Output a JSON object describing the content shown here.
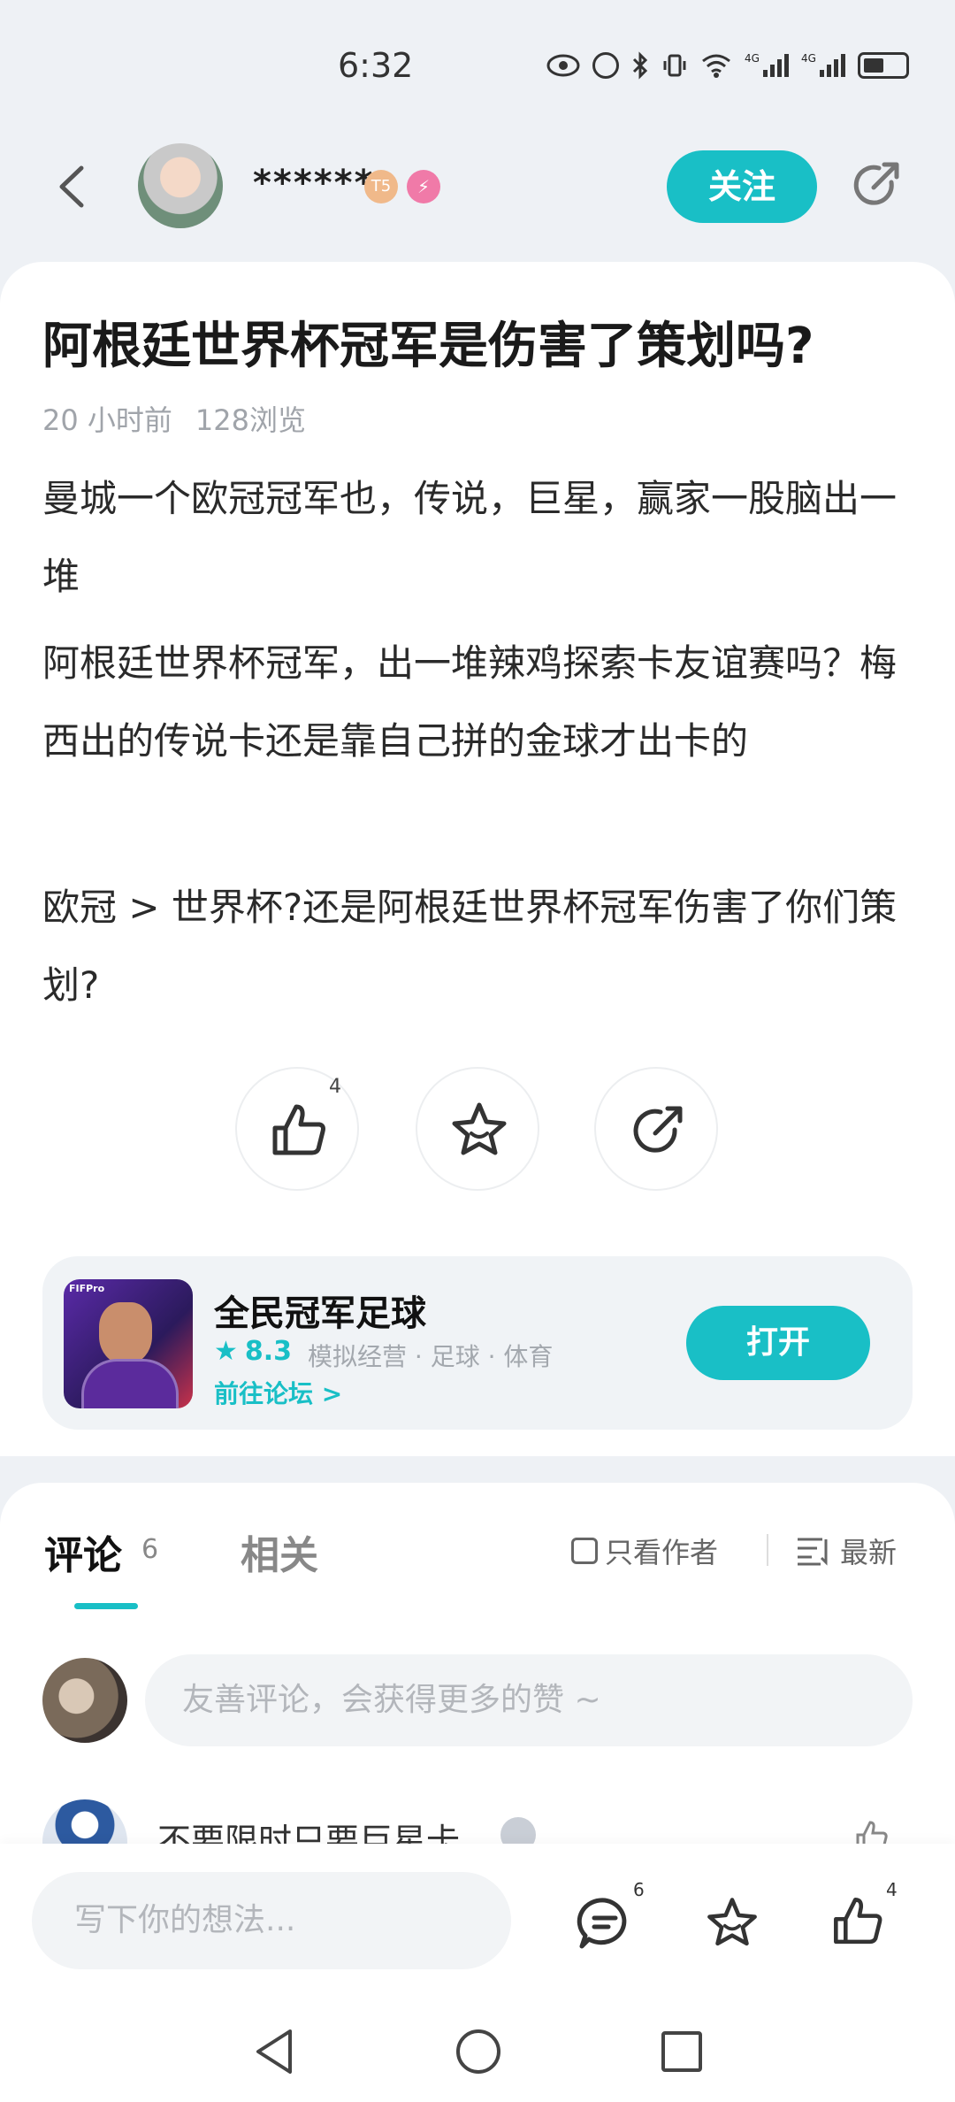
{
  "status_bar": {
    "time": "6:32",
    "network_1": "4G",
    "network_2": "4G"
  },
  "header": {
    "username": "******",
    "badge_1": "T5",
    "follow_label": "关注"
  },
  "post": {
    "title": "阿根廷世界杯冠军是伤害了策划吗?",
    "time_ago": "20 小时前",
    "views": "128浏览",
    "paragraphs": [
      "曼城一个欧冠冠军也，传说，巨星，赢家一股脑出一堆",
      "阿根廷世界杯冠军，出一堆辣鸡探索卡友谊赛吗？梅西出的传说卡还是靠自己拼的金球才出卡的",
      "欧冠 > 世界杯?还是阿根廷世界杯冠军伤害了你们策划?"
    ],
    "like_count": "4"
  },
  "app_card": {
    "icon_tag": "FIFPro",
    "name": "全民冠军足球",
    "rating": "8.3",
    "tags": "模拟经营 · 足球 · 体育",
    "forum_link": "前往论坛 >",
    "open_label": "打开"
  },
  "comments": {
    "tab_comments": "评论",
    "comment_count": "6",
    "tab_related": "相关",
    "filter_author": "只看作者",
    "sort_label": "最新",
    "input_placeholder": "友善评论，会获得更多的赞 ~",
    "peek_name": "不要限时只要巨星卡"
  },
  "bottom_bar": {
    "input_placeholder": "写下你的想法...",
    "comment_count": "6",
    "like_count": "4"
  },
  "colors": {
    "accent": "#19bfc6"
  }
}
